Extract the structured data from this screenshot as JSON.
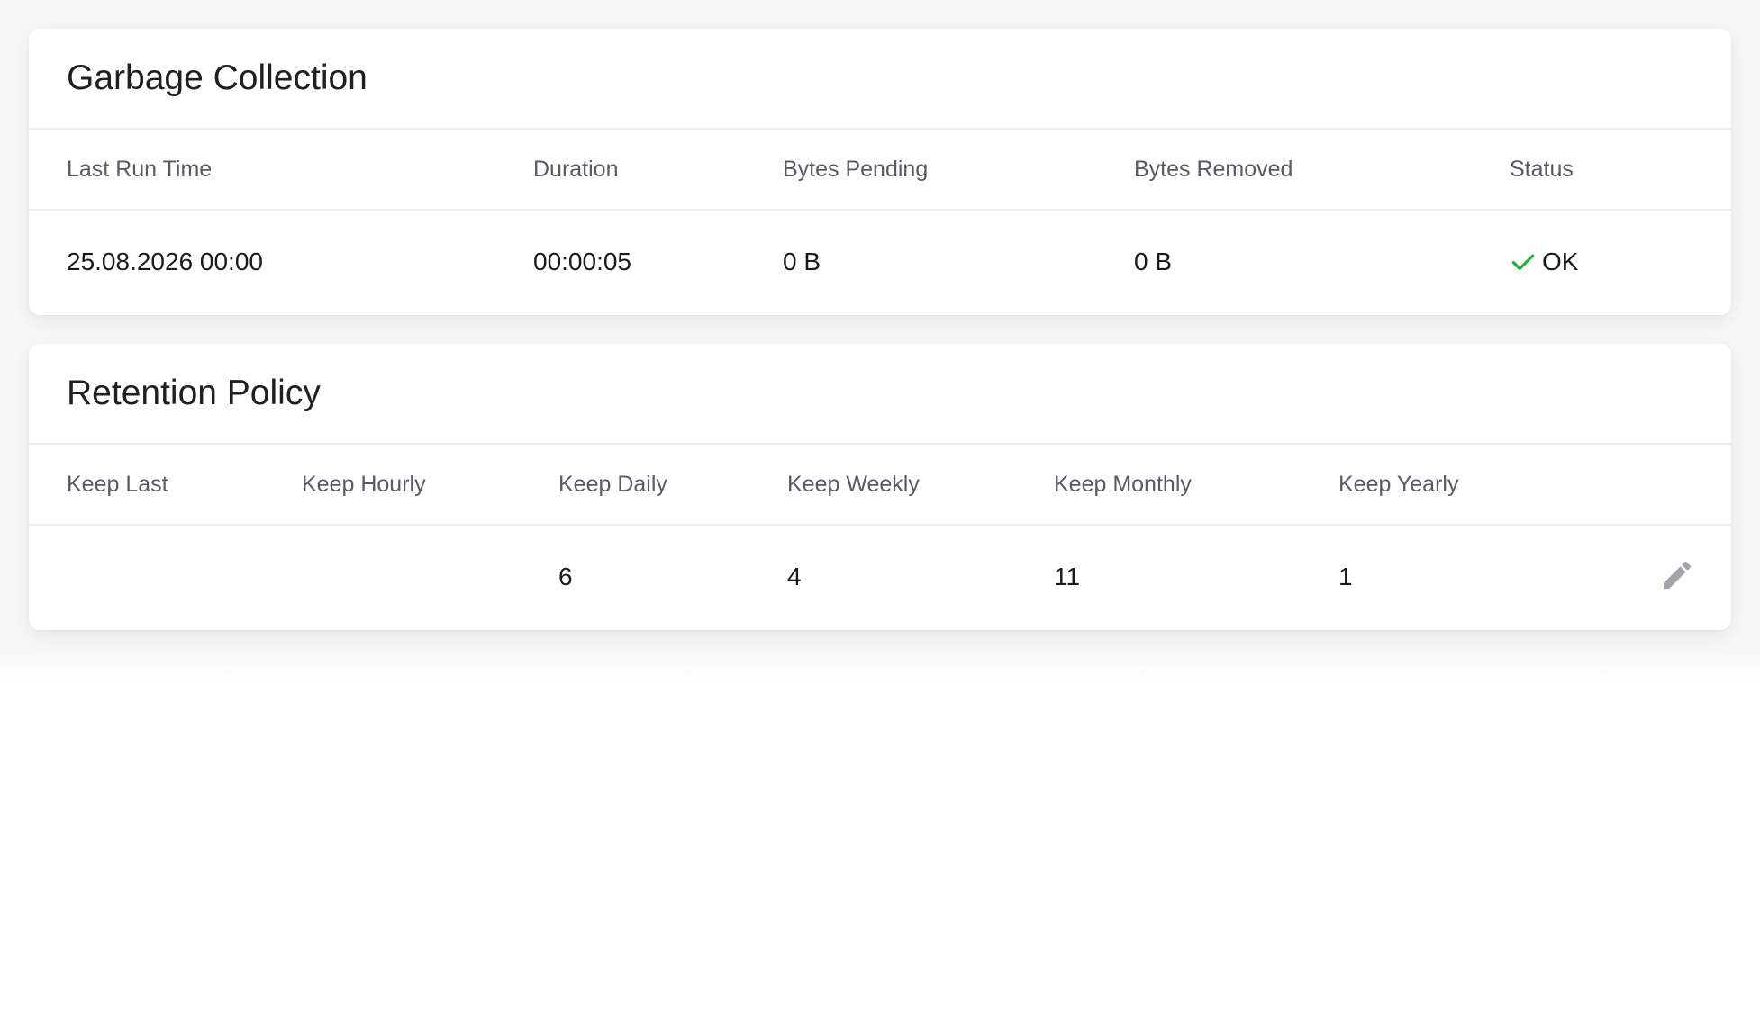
{
  "garbage_collection": {
    "title": "Garbage Collection",
    "columns": [
      "Last Run Time",
      "Duration",
      "Bytes Pending",
      "Bytes Removed",
      "Status"
    ],
    "row": {
      "last_run_time": "25.08.2026 00:00",
      "duration": "00:00:05",
      "bytes_pending": "0 B",
      "bytes_removed": "0 B",
      "status": "OK",
      "status_icon": "check-icon",
      "status_color": "#22b33c"
    }
  },
  "retention_policy": {
    "title": "Retention Policy",
    "columns": [
      "Keep Last",
      "Keep Hourly",
      "Keep Daily",
      "Keep Weekly",
      "Keep Monthly",
      "Keep Yearly"
    ],
    "row": {
      "keep_last": "",
      "keep_hourly": "",
      "keep_daily": "6",
      "keep_weekly": "4",
      "keep_monthly": "11",
      "keep_yearly": "1"
    },
    "edit_icon": "pencil-icon",
    "edit_icon_color": "#a3a3aa"
  }
}
